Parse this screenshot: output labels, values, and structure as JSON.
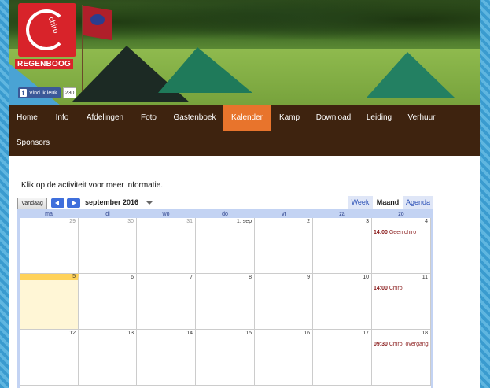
{
  "header": {
    "logo_text": "chiro",
    "logo_name": "REGENBOOG",
    "facebook": {
      "like_label": "Vind ik leuk",
      "count": "230"
    }
  },
  "nav": {
    "items": [
      {
        "label": "Home",
        "active": false
      },
      {
        "label": "Info",
        "active": false
      },
      {
        "label": "Afdelingen",
        "active": false
      },
      {
        "label": "Foto",
        "active": false
      },
      {
        "label": "Gastenboek",
        "active": false
      },
      {
        "label": "Kalender",
        "active": true
      },
      {
        "label": "Kamp",
        "active": false
      },
      {
        "label": "Download",
        "active": false
      },
      {
        "label": "Leiding",
        "active": false
      },
      {
        "label": "Verhuur",
        "active": false
      },
      {
        "label": "Sponsors",
        "active": false
      }
    ],
    "active_color": "#e8742c",
    "bar_color": "#3e230f"
  },
  "content": {
    "intro": "Klik op de activiteit voor meer informatie."
  },
  "calendar": {
    "today_button": "Vandaag",
    "month_label": "september 2016",
    "views": [
      {
        "label": "Week",
        "active": false
      },
      {
        "label": "Maand",
        "active": true
      },
      {
        "label": "Agenda",
        "active": false
      }
    ],
    "days_of_week": [
      "ma",
      "di",
      "wo",
      "do",
      "vr",
      "za",
      "zo"
    ],
    "weeks": [
      [
        {
          "day": "29",
          "dim": true
        },
        {
          "day": "30",
          "dim": true
        },
        {
          "day": "31",
          "dim": true
        },
        {
          "day": "1. sep",
          "dim": false
        },
        {
          "day": "2",
          "dim": false
        },
        {
          "day": "3",
          "dim": false
        },
        {
          "day": "4",
          "dim": false,
          "event_time": "14:00",
          "event_title": "Geen chiro"
        }
      ],
      [
        {
          "day": "5",
          "dim": false,
          "today": true
        },
        {
          "day": "6",
          "dim": false
        },
        {
          "day": "7",
          "dim": false
        },
        {
          "day": "8",
          "dim": false
        },
        {
          "day": "9",
          "dim": false
        },
        {
          "day": "10",
          "dim": false
        },
        {
          "day": "11",
          "dim": false,
          "event_time": "14:00",
          "event_title": "Chiro"
        }
      ],
      [
        {
          "day": "12",
          "dim": false
        },
        {
          "day": "13",
          "dim": false
        },
        {
          "day": "14",
          "dim": false
        },
        {
          "day": "15",
          "dim": false
        },
        {
          "day": "16",
          "dim": false
        },
        {
          "day": "17",
          "dim": false
        },
        {
          "day": "18",
          "dim": false,
          "event_time": "09:30",
          "event_title": "Chiro, overgang"
        }
      ]
    ]
  }
}
